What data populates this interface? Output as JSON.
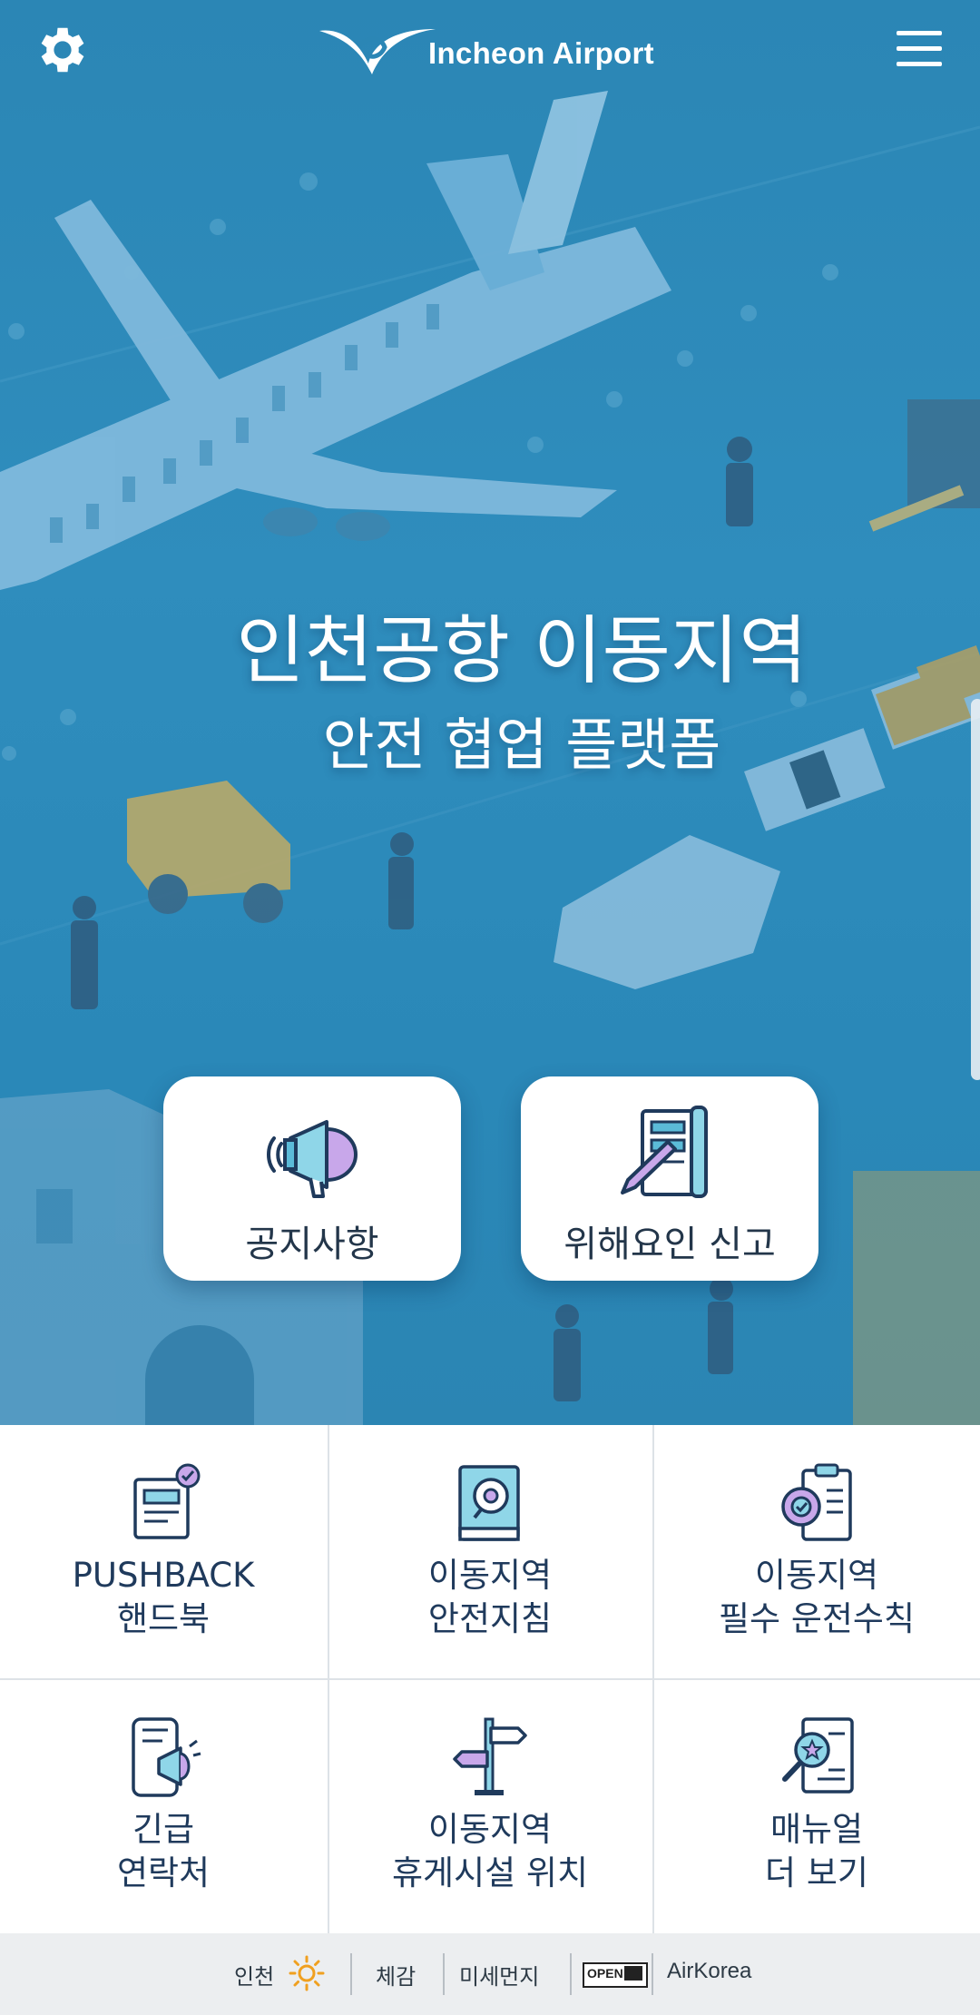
{
  "header": {
    "logo_text": "Incheon Airport",
    "settings_icon": "gear-icon",
    "menu_icon": "hamburger-menu-icon"
  },
  "hero": {
    "title": "인천공항 이동지역",
    "subtitle": "안전 협업 플랫폼",
    "cards": [
      {
        "label": "공지사항",
        "icon": "megaphone-icon"
      },
      {
        "label": "위해요인 신고",
        "icon": "report-document-icon"
      }
    ]
  },
  "grid": {
    "tiles": [
      {
        "line1": "PUSHBACK",
        "line2": "핸드북",
        "icon": "handbook-icon"
      },
      {
        "line1": "이동지역",
        "line2": "안전지침",
        "icon": "safety-guide-book-icon"
      },
      {
        "line1": "이동지역",
        "line2": "필수 운전수칙",
        "icon": "driving-rules-clipboard-icon"
      },
      {
        "line1": "긴급",
        "line2": "연락처",
        "icon": "emergency-phone-icon"
      },
      {
        "line1": "이동지역",
        "line2": "휴게시설 위치",
        "icon": "signpost-icon"
      },
      {
        "line1": "매뉴얼",
        "line2": "더 보기",
        "icon": "manual-search-icon"
      }
    ]
  },
  "footer": {
    "location": "인천",
    "weather_icon": "sun-icon",
    "feels_like_label": "체감",
    "fine_dust_label": "미세먼지",
    "open_badge": "OPEN",
    "source": "AirKorea"
  },
  "colors": {
    "hero_blue": "#2b86b5",
    "text_dark": "#1f3a5c",
    "icon_accent": "#3aa0c8",
    "footer_bg": "#eceef0"
  }
}
